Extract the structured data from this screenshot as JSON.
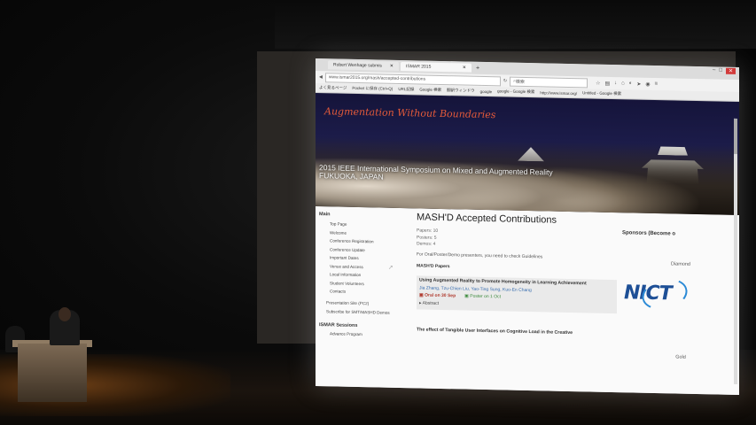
{
  "browser": {
    "tabs": [
      {
        "label": "Robert Wenhage submis",
        "active": false
      },
      {
        "label": "ISMAR 2015",
        "active": true
      }
    ],
    "new_tab": "+",
    "url": "www.ismar2015.org/mash/accepted-contributions",
    "search_placeholder": "検索",
    "bookmarks": [
      "よく見るページ",
      "Pocket に保存 (Ctrl+Q)",
      "URL記録",
      "Google 検索",
      "翻訳ウィンドウ",
      "google",
      "google - Google 検索",
      "http://www.ismar.org/",
      "Untitled - Google 検索"
    ]
  },
  "banner": {
    "title": "Augmentation Without Boundaries",
    "subtitle_line1": "2015 IEEE International Symposium on Mixed and Augmented Reality",
    "subtitle_line2": "FUKUOKA, JAPAN"
  },
  "sidebar": {
    "heading": "Main",
    "items": [
      "Top Page",
      "Welcome",
      "Conference Registration",
      "Conference Update",
      "Important Dates",
      "Venue and Access",
      "Local Information",
      "Student Volunteers",
      "Contacts"
    ],
    "extra_items": [
      "Presentation Site (PC2)",
      "Subscribe for SMT/MASHD Demos"
    ],
    "heading2": "ISMAR Sessions",
    "items2": [
      "Advance Program"
    ]
  },
  "main": {
    "title": "MASH'D Accepted Contributions",
    "stats": [
      "Papers: 10",
      "Posters: 5",
      "Demos: 4"
    ],
    "note": "For Oral/Poster/Demo presenters, you need to check Guidelines",
    "section": "MASH'D Papers",
    "paper1": {
      "title": "Using Augmented Reality to Promote Homogeneity in Learning Achievement",
      "authors": "Jia Zhang, Tzu-Chien Liu, Yao-Ting Sung, Kuo-En Chang",
      "oral": "Oral on 30 Sep",
      "poster": "Poster on 1 Oct",
      "abstract": "Abstract"
    },
    "paper2_title": "The effect of Tangible User Interfaces on Cognitive Load in the Creative"
  },
  "sponsors": {
    "heading": "Sponsors (Become o",
    "tier1": "Diamond",
    "logo": "NICT",
    "tier2": "Gold"
  },
  "colors": {
    "banner_title": "#e45a3a",
    "nict_blue": "#1d4f96",
    "authors_link": "#3a6fb0",
    "oral": "#b03a2e",
    "poster": "#3a8a3a"
  }
}
